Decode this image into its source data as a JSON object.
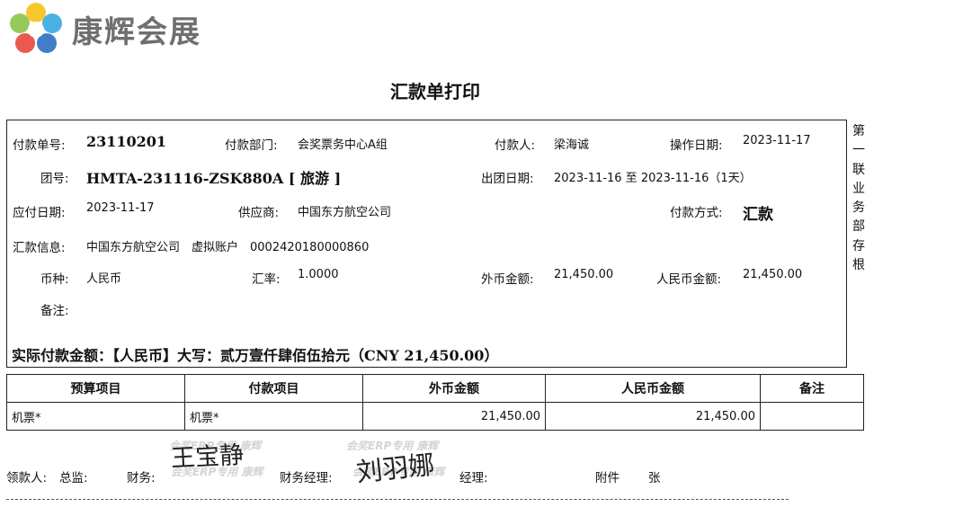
{
  "brand": {
    "name": "康辉会展"
  },
  "title": "汇款单打印",
  "side_note": [
    "第",
    "一",
    "联",
    "业",
    "务",
    "部",
    "存",
    "根"
  ],
  "form": {
    "pay_no": {
      "label": "付款单号:",
      "value": "23110201"
    },
    "pay_dept": {
      "label": "付款部门:",
      "value": "会奖票务中心A组"
    },
    "payer": {
      "label": "付款人:",
      "value": "梁海诚"
    },
    "op_date": {
      "label": "操作日期:",
      "value": "2023-11-17"
    },
    "group_no": {
      "label": "团号:",
      "value": "HMTA-231116-ZSK880A [ 旅游 ]"
    },
    "depart_date": {
      "label": "出团日期:",
      "value": "2023-11-16 至 2023-11-16（1天）"
    },
    "due_date": {
      "label": "应付日期:",
      "value": "2023-11-17"
    },
    "supplier": {
      "label": "供应商:",
      "value": "中国东方航空公司"
    },
    "pay_method": {
      "label": "付款方式:",
      "value": "汇款"
    },
    "remit_info": {
      "label": "汇款信息:",
      "value": "中国东方航空公司　虚拟账户　0002420180000860"
    },
    "currency": {
      "label": "币种:",
      "value": "人民币"
    },
    "rate": {
      "label": "汇率:",
      "value": "1.0000"
    },
    "fx_amount": {
      "label": "外币金额:",
      "value": "21,450.00"
    },
    "rmb_amount": {
      "label": "人民币金额:",
      "value": "21,450.00"
    },
    "remark": {
      "label": "备注:",
      "value": ""
    }
  },
  "actual_amount": {
    "text": "实际付款金额：【人民币】大写：贰万壹仟肆佰伍拾元",
    "cny": "（CNY 21,450.00）"
  },
  "table": {
    "headers": [
      "预算项目",
      "付款项目",
      "外币金额",
      "人民币金额",
      "备注"
    ],
    "rows": [
      [
        "机票*",
        "机票*",
        "21,450.00",
        "21,450.00",
        ""
      ]
    ]
  },
  "signatures": {
    "receiver_label": "领款人:",
    "director_label": "总监:",
    "finance_label": "财务:",
    "finance_sign": "王宝静",
    "fin_manager_label": "财务经理:",
    "fin_manager_sign": "刘羽娜",
    "manager_label": "经理:",
    "attachment_label": "附件",
    "attachment_unit": "张",
    "watermark": "会奖ERP专用 康辉"
  }
}
